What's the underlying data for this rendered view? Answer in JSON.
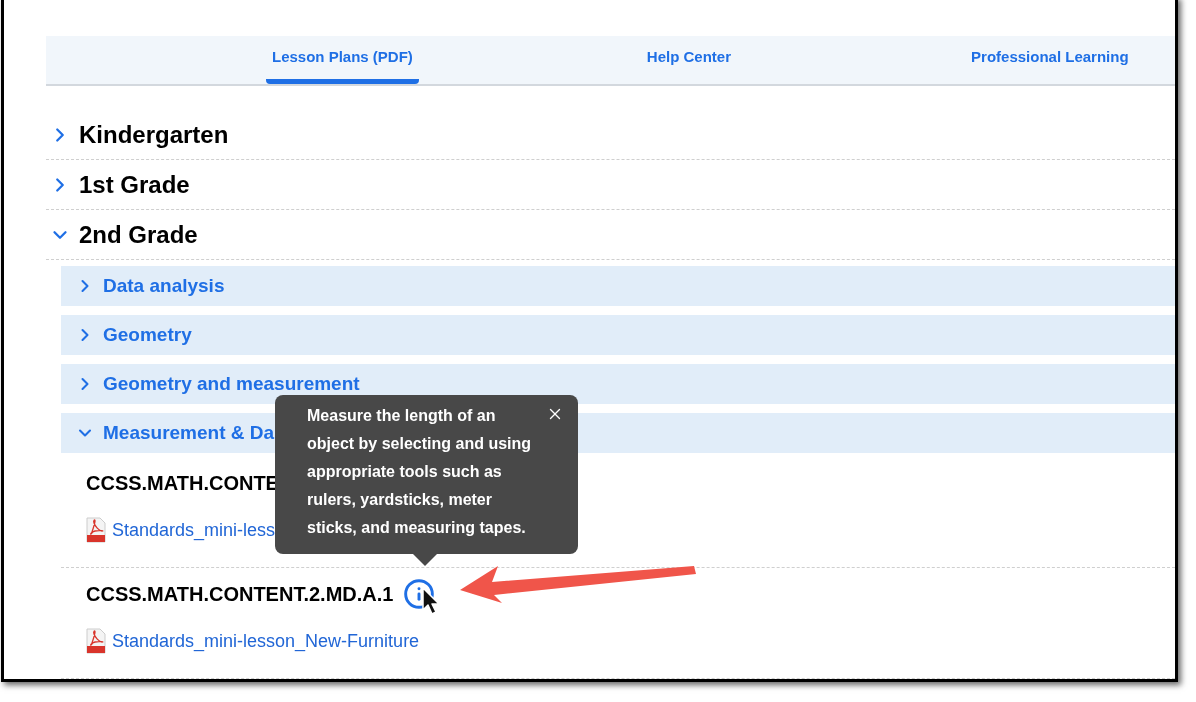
{
  "tabs": [
    {
      "label": "Lesson Plans (PDF)",
      "selected": true
    },
    {
      "label": "Help Center",
      "selected": false
    },
    {
      "label": "Professional Learning",
      "selected": false
    }
  ],
  "grades": [
    {
      "title": "Kindergarten",
      "expanded": false
    },
    {
      "title": "1st Grade",
      "expanded": false
    },
    {
      "title": "2nd Grade",
      "expanded": true,
      "topics": [
        {
          "title": "Data analysis",
          "expanded": false
        },
        {
          "title": "Geometry",
          "expanded": false
        },
        {
          "title": "Geometry and measurement",
          "expanded": false
        },
        {
          "title": "Measurement & Da",
          "expanded": true,
          "standards": [
            {
              "code": "CCSS.MATH.CONTE",
              "has_info": false,
              "file": "Standards_mini-less"
            },
            {
              "code": "CCSS.MATH.CONTENT.2.MD.A.1",
              "has_info": true,
              "file": "Standards_mini-lesson_New-Furniture"
            }
          ]
        }
      ]
    }
  ],
  "tooltip": {
    "text": "Measure the length of an object by selecting and using appropriate tools such as rulers, yardsticks, meter sticks, and measuring tapes."
  }
}
